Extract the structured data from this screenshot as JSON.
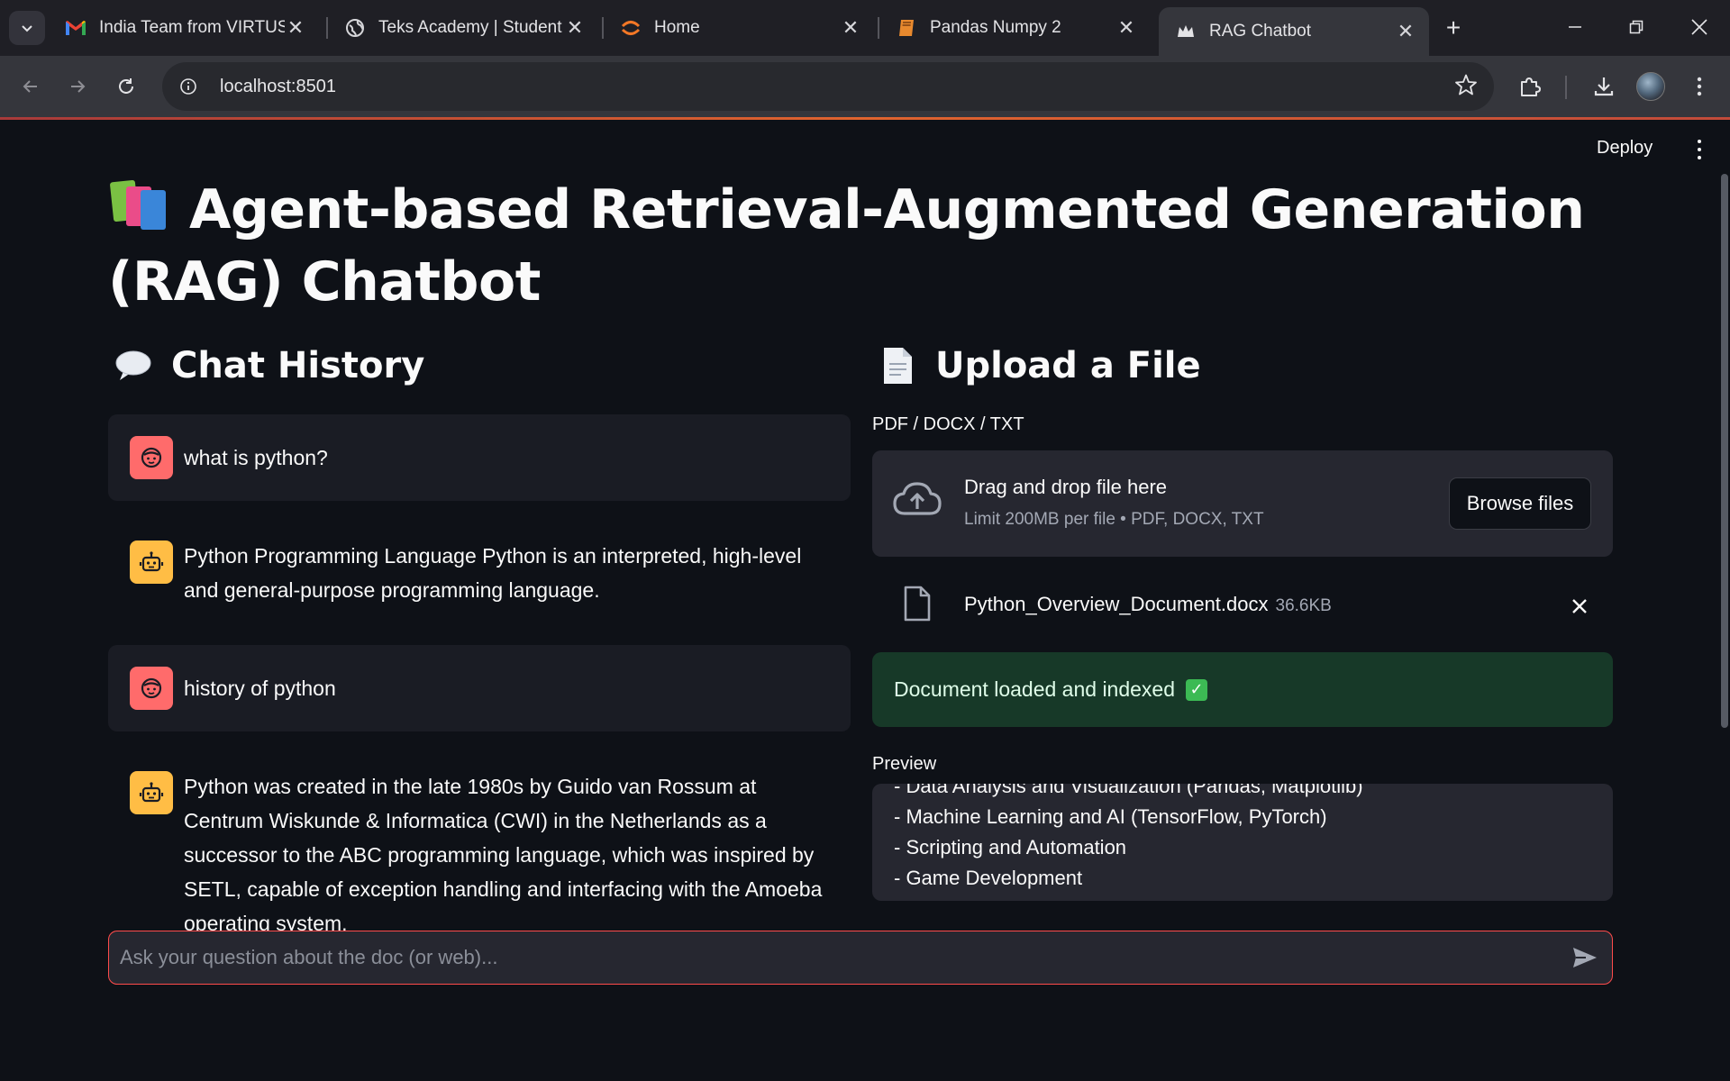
{
  "browser": {
    "tabs": [
      {
        "title": "India Team from VIRTUSA",
        "icon": "gmail-icon"
      },
      {
        "title": "Teks Academy | Student",
        "icon": "globe-icon"
      },
      {
        "title": "Home",
        "icon": "jupyter-icon"
      },
      {
        "title": "Pandas Numpy 2",
        "icon": "book-icon"
      },
      {
        "title": "RAG Chatbot",
        "icon": "streamlit-crown-icon"
      }
    ],
    "active_tab_index": 4,
    "url": "localhost:8501"
  },
  "app": {
    "deploy_label": "Deploy",
    "title": "Agent-based Retrieval-Augmented Generation (RAG) Chatbot",
    "chat_history": {
      "heading": "Chat History",
      "messages": [
        {
          "role": "user",
          "text": "what is python?"
        },
        {
          "role": "assistant",
          "text": "Python Programming Language Python is an interpreted, high-level and general-purpose programming language."
        },
        {
          "role": "user",
          "text": "history of python"
        },
        {
          "role": "assistant",
          "text": "Python was created in the late 1980s by Guido van Rossum at Centrum Wiskunde & Informatica (CWI) in the Netherlands as a successor to the ABC programming language, which was inspired by SETL, capable of exception handling and interfacing with the Amoeba operating system."
        }
      ]
    },
    "upload": {
      "heading": "Upload a File",
      "label": "PDF / DOCX / TXT",
      "drop_title": "Drag and drop file here",
      "drop_subtitle": "Limit 200MB per file • PDF, DOCX, TXT",
      "browse_label": "Browse files",
      "file_name": "Python_Overview_Document.docx",
      "file_size": "36.6KB",
      "success_message": "Document loaded and indexed",
      "preview_label": "Preview",
      "preview_lines": "- Data Analysis and Visualization (Pandas, Matplotlib)\n- Machine Learning and AI (TensorFlow, PyTorch)\n- Scripting and Automation\n- Game Development\n- Desktop GUI Applications"
    },
    "chat_input": {
      "placeholder": "Ask your question about the doc (or web)..."
    },
    "colors": {
      "background": "#0e1117",
      "user_avatar": "#ff6b6b",
      "assistant_avatar": "#ffbd45",
      "success_bg": "#173928",
      "accent": "#ff4b4b"
    }
  }
}
